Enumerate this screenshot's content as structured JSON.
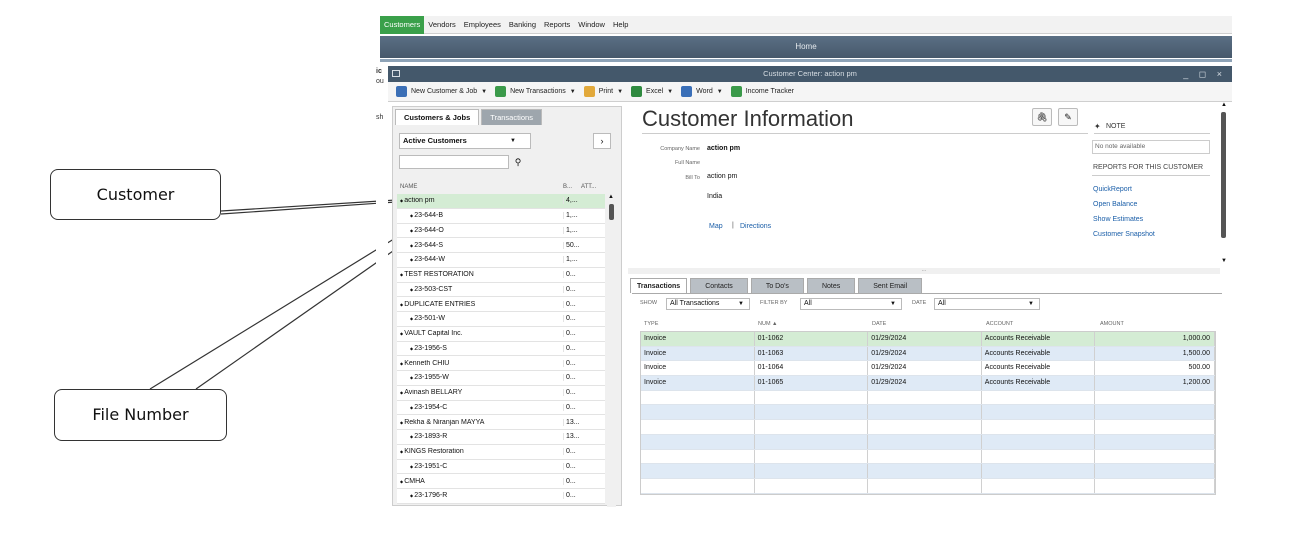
{
  "menubar": {
    "items": [
      "Customers",
      "Vendors",
      "Employees",
      "Banking",
      "Reports",
      "Window",
      "Help"
    ]
  },
  "home_bar": {
    "title": "Home"
  },
  "left_fragment": {
    "glyphs": [
      "ic",
      "ou",
      "sh"
    ]
  },
  "window": {
    "title": "Customer Center: action pm",
    "controls": "_ ◻ ×"
  },
  "toolbar": {
    "items": [
      {
        "label": "New Customer & Job",
        "dropdown": true,
        "icon": "person-plus-icon",
        "color": "#3b6fb6"
      },
      {
        "label": "New Transactions",
        "dropdown": true,
        "icon": "document-icon",
        "color": "#3b9a4a"
      },
      {
        "label": "Print",
        "dropdown": true,
        "icon": "printer-icon",
        "color": "#e2a93b"
      },
      {
        "label": "Excel",
        "dropdown": true,
        "icon": "excel-icon",
        "color": "#2f8a3f"
      },
      {
        "label": "Word",
        "dropdown": true,
        "icon": "word-icon",
        "color": "#3a6fb8"
      },
      {
        "label": "Income Tracker",
        "dropdown": false,
        "icon": "chart-icon",
        "color": "#3b9a4a"
      }
    ]
  },
  "left_panel": {
    "tabs": [
      "Customers & Jobs",
      "Transactions"
    ],
    "filter": "Active Customers",
    "search_placeholder": "",
    "columns": [
      "NAME",
      "B...",
      "ATT..."
    ],
    "rows": [
      {
        "name": "action pm",
        "balance": "4,...",
        "child": false,
        "selected": true
      },
      {
        "name": "23-644-B",
        "balance": "1,...",
        "child": true
      },
      {
        "name": "23-644-O",
        "balance": "1,...",
        "child": true
      },
      {
        "name": "23-644-S",
        "balance": "50...",
        "child": true
      },
      {
        "name": "23-644-W",
        "balance": "1,...",
        "child": true
      },
      {
        "name": "TEST RESTORATION",
        "balance": "0...",
        "child": false
      },
      {
        "name": "23-503-CST",
        "balance": "0...",
        "child": true
      },
      {
        "name": "DUPLICATE ENTRIES",
        "balance": "0...",
        "child": false
      },
      {
        "name": "23-501-W",
        "balance": "0...",
        "child": true
      },
      {
        "name": "VAULT Capital Inc.",
        "balance": "0...",
        "child": false
      },
      {
        "name": "23-1956-S",
        "balance": "0...",
        "child": true
      },
      {
        "name": "Kenneth CHIU",
        "balance": "0...",
        "child": false
      },
      {
        "name": "23-1955-W",
        "balance": "0...",
        "child": true
      },
      {
        "name": "Avinash BELLARY",
        "balance": "0...",
        "child": false
      },
      {
        "name": "23-1954-C",
        "balance": "0...",
        "child": true
      },
      {
        "name": "Rekha & Niranjan MAYYA",
        "balance": "13...",
        "child": false
      },
      {
        "name": "23-1893-R",
        "balance": "13...",
        "child": true
      },
      {
        "name": "KINGS Restoration",
        "balance": "0...",
        "child": false
      },
      {
        "name": "23-1951-C",
        "balance": "0...",
        "child": true
      },
      {
        "name": "CMHA",
        "balance": "0...",
        "child": false
      },
      {
        "name": "23-1796-R",
        "balance": "0...",
        "child": true
      }
    ]
  },
  "customer_info": {
    "title": "Customer Information",
    "fields": [
      {
        "label": "Company Name",
        "value": "action pm",
        "bold": true
      },
      {
        "label": "Full Name",
        "value": ""
      },
      {
        "label": "Bill To",
        "value": "action pm"
      },
      {
        "label": "",
        "value": "India"
      }
    ],
    "links": {
      "map": "Map",
      "sep": "|",
      "directions": "Directions"
    },
    "note": {
      "label": "NOTE",
      "text": "No note available"
    },
    "reports": {
      "label": "REPORTS FOR THIS CUSTOMER",
      "items": [
        "QuickReport",
        "Open Balance",
        "Show Estimates",
        "Customer Snapshot"
      ]
    }
  },
  "tx_tabs": [
    "Transactions",
    "Contacts",
    "To Do's",
    "Notes",
    "Sent Email"
  ],
  "tx_filters": {
    "show_label": "SHOW",
    "show_value": "All Transactions",
    "filter_label": "FILTER BY",
    "filter_value": "All",
    "date_label": "DATE",
    "date_value": "All"
  },
  "tx_columns": [
    "TYPE",
    "NUM ▲",
    "DATE",
    "ACCOUNT",
    "AMOUNT"
  ],
  "tx_rows": [
    {
      "type": "Invoice",
      "num": "01-1062",
      "date": "01/29/2024",
      "account": "Accounts Receivable",
      "amount": "1,000.00"
    },
    {
      "type": "Invoice",
      "num": "01-1063",
      "date": "01/29/2024",
      "account": "Accounts Receivable",
      "amount": "1,500.00"
    },
    {
      "type": "Invoice",
      "num": "01-1064",
      "date": "01/29/2024",
      "account": "Accounts Receivable",
      "amount": "500.00"
    },
    {
      "type": "Invoice",
      "num": "01-1065",
      "date": "01/29/2024",
      "account": "Accounts Receivable",
      "amount": "1,200.00"
    }
  ],
  "callouts": {
    "customer": "Customer",
    "file_number": "File Number"
  }
}
